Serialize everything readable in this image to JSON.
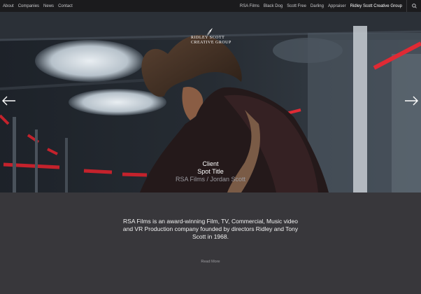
{
  "nav": {
    "left": [
      "About",
      "Companies",
      "News",
      "Contact"
    ],
    "right": [
      "RSA Films",
      "Black Dog",
      "Scott Free",
      "Darling",
      "Appraiser",
      "Ridley Scott Creative Group"
    ],
    "active": "Ridley Scott Creative Group",
    "search_icon": "search-icon"
  },
  "hero": {
    "logo": {
      "line1": "RIDLEY SCOTT",
      "line2": "CREATIVE GROUP"
    },
    "caption": {
      "client": "Client",
      "spot_title": "Spot Title",
      "credit": "RSA Films / Jordan Scott"
    },
    "prev_icon": "arrow-left-icon",
    "next_icon": "arrow-right-icon"
  },
  "about": {
    "text": "RSA Films is an award-winning Film, TV, Commercial, Music video and VR Production company founded by directors Ridley and Tony Scott in 1968.",
    "read_more": "Read More"
  },
  "colors": {
    "nav_bg": "#1b1b1d",
    "section_bg": "#38373b",
    "accent_red": "#e02a34"
  }
}
